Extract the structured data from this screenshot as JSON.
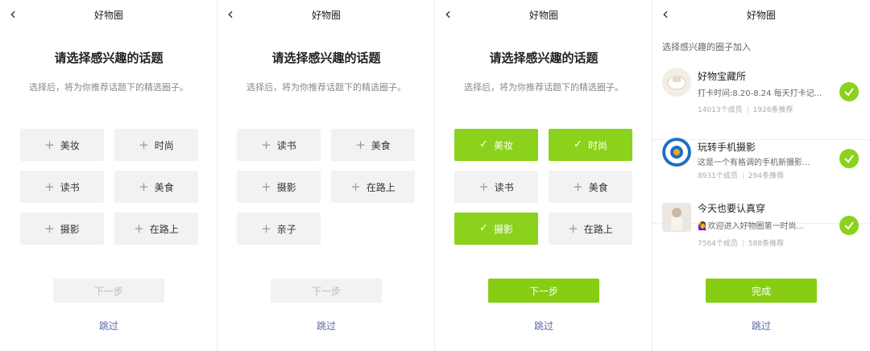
{
  "app_title": "好物圈",
  "back_icon": "chevron-left-icon",
  "question_title": "请选择感兴趣的话题",
  "question_desc": "选择后，将为你推荐话题下的精选圈子。",
  "topics": {
    "makeup": "美妆",
    "fashion": "时尚",
    "reading": "读书",
    "food": "美食",
    "photo": "摄影",
    "travel": "在路上",
    "parenting": "亲子"
  },
  "next_label": "下一步",
  "skip_label": "跳过",
  "circles_label": "选择感兴趣的圈子加入",
  "circles": [
    {
      "name": "好物宝藏所",
      "desc": "打卡时间:8.20-8.24 每天打卡记...",
      "members": "14013个成员",
      "posts": "1926条推荐"
    },
    {
      "name": "玩转手机摄影",
      "desc": "这是一个有格调的手机新摄影...",
      "members": "8931个成员",
      "posts": "294条推荐"
    },
    {
      "name": "今天也要认真穿",
      "desc": "🙋‍♀️欢迎进入好物圈第一时尚...",
      "members": "7564个成员",
      "posts": "588条推荐"
    }
  ],
  "done_label": "完成",
  "colors": {
    "accent": "#8bd21c",
    "link": "#5a6aa6"
  }
}
